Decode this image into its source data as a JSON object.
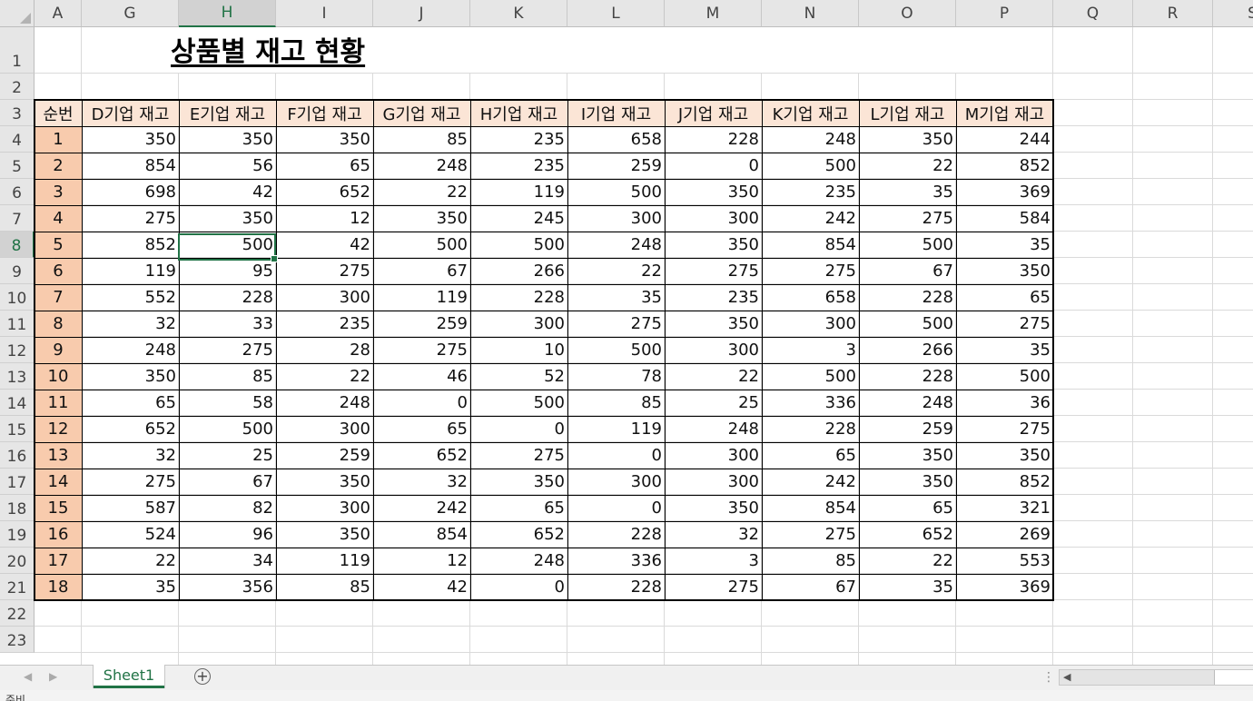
{
  "spreadsheet": {
    "title": "상품별 재고 현황",
    "columns": [
      "A",
      "G",
      "H",
      "I",
      "J",
      "K",
      "L",
      "M",
      "N",
      "O",
      "P",
      "Q",
      "R",
      "S"
    ],
    "selected_column": "H",
    "selected_row": 8,
    "rows": [
      1,
      2,
      3,
      4,
      5,
      6,
      7,
      8,
      9,
      10,
      11,
      12,
      13,
      14,
      15,
      16,
      17,
      18,
      19,
      20,
      21,
      22,
      23
    ],
    "table_headers": [
      "순번",
      "D기업 재고",
      "E기업 재고",
      "F기업 재고",
      "G기업 재고",
      "H기업 재고",
      "I기업 재고",
      "J기업 재고",
      "K기업 재고",
      "L기업 재고",
      "M기업 재고"
    ],
    "table_rows": [
      [
        1,
        350,
        350,
        350,
        85,
        235,
        658,
        228,
        248,
        350,
        244
      ],
      [
        2,
        854,
        56,
        65,
        248,
        235,
        259,
        0,
        500,
        22,
        852
      ],
      [
        3,
        698,
        42,
        652,
        22,
        119,
        500,
        350,
        235,
        35,
        369
      ],
      [
        4,
        275,
        350,
        12,
        350,
        245,
        300,
        300,
        242,
        275,
        584
      ],
      [
        5,
        852,
        500,
        42,
        500,
        500,
        248,
        350,
        854,
        500,
        35
      ],
      [
        6,
        119,
        95,
        275,
        67,
        266,
        22,
        275,
        275,
        67,
        350
      ],
      [
        7,
        552,
        228,
        300,
        119,
        228,
        35,
        235,
        658,
        228,
        65
      ],
      [
        8,
        32,
        33,
        235,
        259,
        300,
        275,
        350,
        300,
        500,
        275
      ],
      [
        9,
        248,
        275,
        28,
        275,
        10,
        500,
        300,
        3,
        266,
        35
      ],
      [
        10,
        350,
        85,
        22,
        46,
        52,
        78,
        22,
        500,
        228,
        500
      ],
      [
        11,
        65,
        58,
        248,
        0,
        500,
        85,
        25,
        336,
        248,
        36
      ],
      [
        12,
        652,
        500,
        300,
        65,
        0,
        119,
        248,
        228,
        259,
        275
      ],
      [
        13,
        32,
        25,
        259,
        652,
        275,
        0,
        300,
        65,
        350,
        350
      ],
      [
        14,
        275,
        67,
        350,
        32,
        350,
        300,
        300,
        242,
        350,
        852
      ],
      [
        15,
        587,
        82,
        300,
        242,
        65,
        0,
        350,
        854,
        65,
        321
      ],
      [
        16,
        524,
        96,
        350,
        854,
        652,
        228,
        32,
        275,
        652,
        269
      ],
      [
        17,
        22,
        34,
        119,
        12,
        248,
        336,
        3,
        85,
        22,
        553
      ],
      [
        18,
        35,
        356,
        85,
        42,
        0,
        228,
        275,
        67,
        35,
        369
      ]
    ]
  },
  "tabs": {
    "sheets": [
      "Sheet1"
    ],
    "active": "Sheet1",
    "add_icon": "plus-circle-icon"
  },
  "status_bar": {
    "text": "준비"
  },
  "colors": {
    "accent": "#217346",
    "header_fill": "#fbe5d6",
    "index_fill": "#f8cbad"
  }
}
